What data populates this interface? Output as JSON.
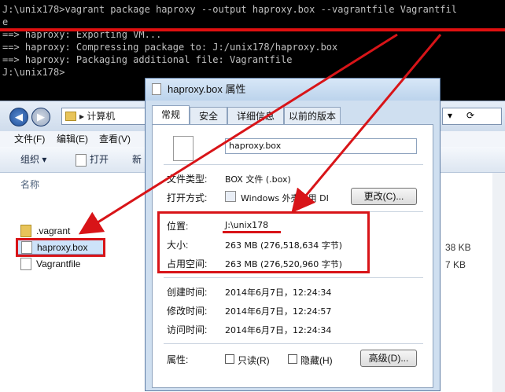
{
  "console": {
    "lines": [
      "J:\\unix178>vagrant package haproxy --output haproxy.box --vagrantfile Vagrantfil",
      "e",
      "==> haproxy: Exporting VM...",
      "==> haproxy: Compressing package to: J:/unix178/haproxy.box",
      "==> haproxy: Packaging additional file: Vagrantfile",
      "",
      "J:\\unix178>"
    ]
  },
  "explorer": {
    "address": "▸ 计算机",
    "menu": {
      "file": "文件(F)",
      "edit": "编辑(E)",
      "view": "查看(V)"
    },
    "toolbar": {
      "organize": "组织 ▾",
      "open": "打开",
      "new": "新"
    },
    "column_name": "名称",
    "files": [
      {
        "name": ".vagrant",
        "type": "folder"
      },
      {
        "name": "haproxy.box",
        "type": "file",
        "size": "38 KB"
      },
      {
        "name": "Vagrantfile",
        "type": "file",
        "size": "7 KB"
      }
    ]
  },
  "dialog": {
    "title": "haproxy.box 属性",
    "tabs": [
      "常规",
      "安全",
      "详细信息",
      "以前的版本"
    ],
    "filename": "haproxy.box",
    "file_type_label": "文件类型:",
    "file_type_value": "BOX 文件 (.box)",
    "open_with_label": "打开方式:",
    "open_with_value": "Windows 外壳公用 DI",
    "change_button": "更改(C)...",
    "location_label": "位置:",
    "location_value": "J:\\unix178",
    "size_label": "大小:",
    "size_value": "263 MB (276,518,634 字节)",
    "size_on_disk_label": "占用空间:",
    "size_on_disk_value": "263 MB (276,520,960 字节)",
    "created_label": "创建时间:",
    "created_value": "2014年6月7日，12:24:34",
    "modified_label": "修改时间:",
    "modified_value": "2014年6月7日，12:24:57",
    "accessed_label": "访问时间:",
    "accessed_value": "2014年6月7日，12:24:34",
    "attributes_label": "属性:",
    "readonly_label": "只读(R)",
    "hidden_label": "隐藏(H)",
    "advanced_button": "高级(D)..."
  },
  "colors": {
    "highlight": "#d81418"
  }
}
